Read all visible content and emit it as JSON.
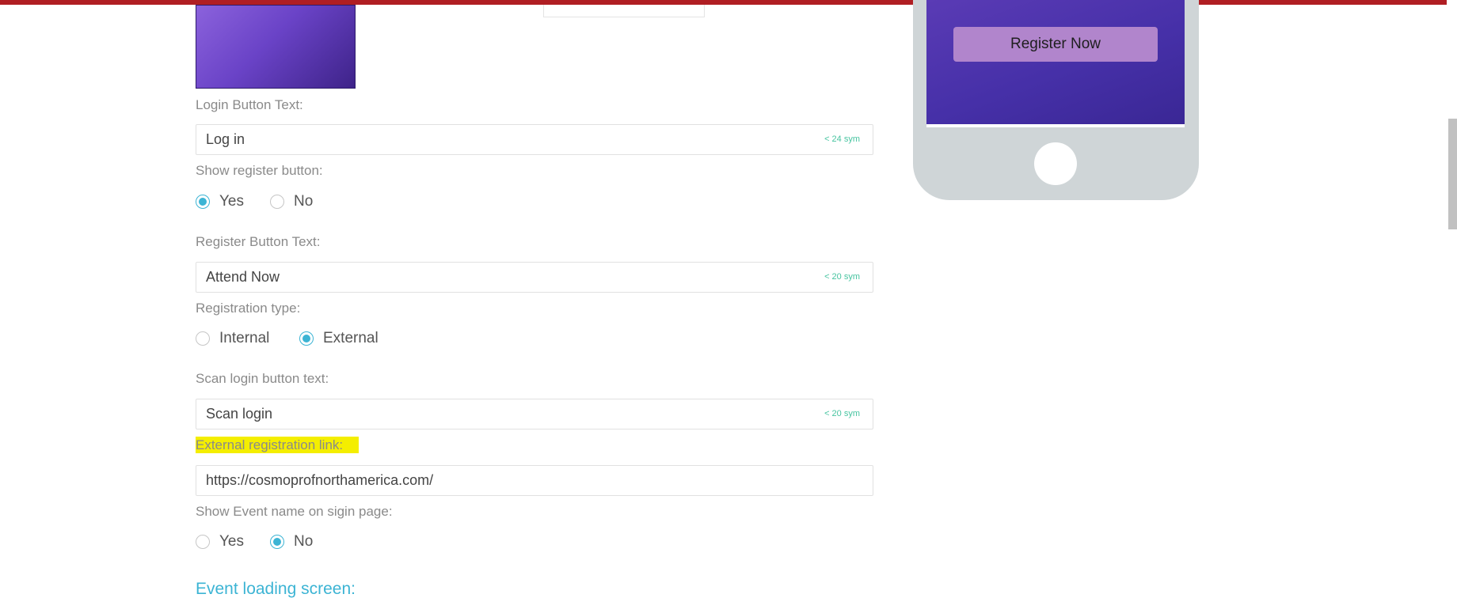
{
  "colors": {
    "top_bar": "#b01e23",
    "accent": "#3cb4d4",
    "hint": "#47c4a0",
    "highlight": "#f4ee00"
  },
  "form": {
    "login_button": {
      "label": "Login Button Text:",
      "value": "Log in",
      "hint": "< 24 sym"
    },
    "show_register": {
      "label": "Show register button:",
      "options": [
        {
          "label": "Yes",
          "selected": true
        },
        {
          "label": "No",
          "selected": false
        }
      ]
    },
    "register_button": {
      "label": "Register Button Text:",
      "value": "Attend Now",
      "hint": "< 20 sym"
    },
    "registration_type": {
      "label": "Registration type:",
      "options": [
        {
          "label": "Internal",
          "selected": false
        },
        {
          "label": "External",
          "selected": true
        }
      ]
    },
    "scan_login": {
      "label": "Scan login button text:",
      "value": "Scan login",
      "hint": "< 20 sym"
    },
    "external_link": {
      "label": "External registration link:",
      "value": "https://cosmoprofnorthamerica.com/"
    },
    "show_event_name": {
      "label": "Show Event name on sigin page:",
      "options": [
        {
          "label": "Yes",
          "selected": false
        },
        {
          "label": "No",
          "selected": true
        }
      ]
    },
    "section_title": "Event loading screen:"
  },
  "preview": {
    "register_button_label": "Register Now"
  }
}
